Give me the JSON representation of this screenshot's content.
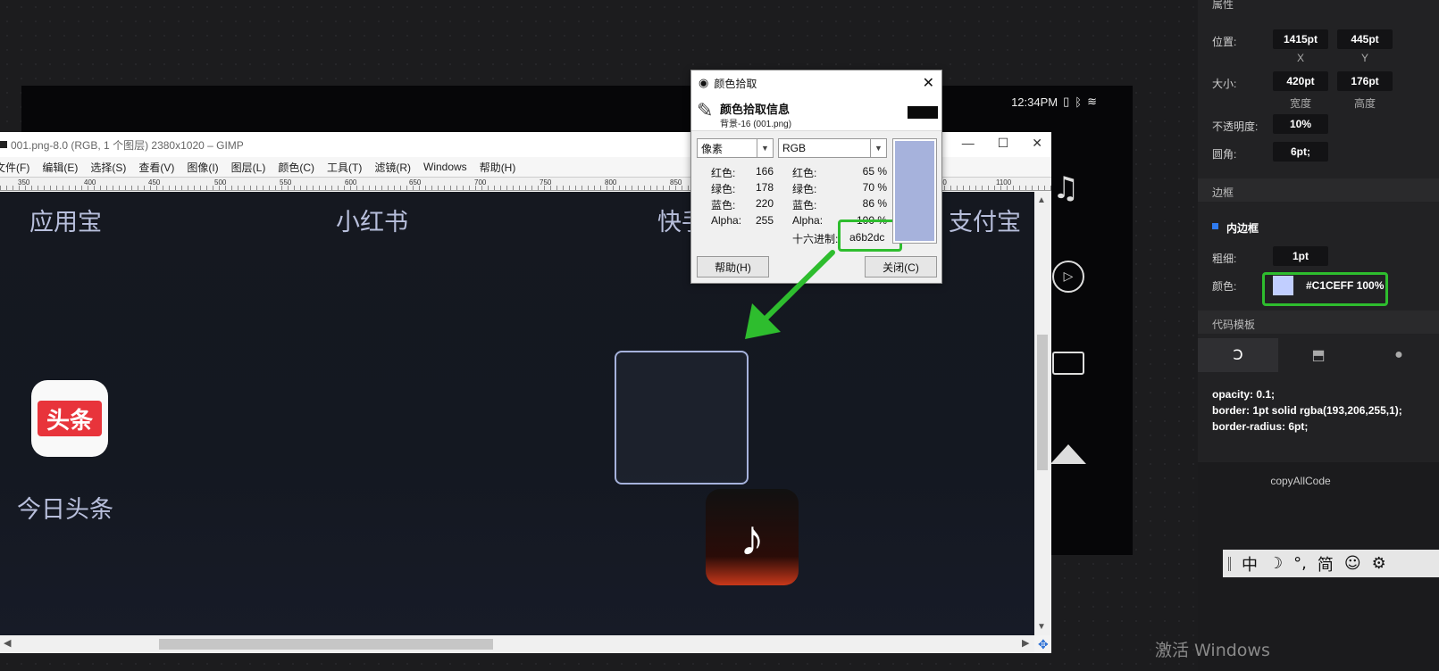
{
  "phone": {
    "time": "12:34PM"
  },
  "gimp": {
    "title": "001.png-8.0 (RGB, 1 个图层) 2380x1020 – GIMP",
    "menu": [
      "文件(F)",
      "编辑(E)",
      "选择(S)",
      "查看(V)",
      "图像(I)",
      "图层(L)",
      "颜色(C)",
      "工具(T)",
      "滤镜(R)",
      "Windows",
      "帮助(H)"
    ],
    "ruler_ticks": [
      "350",
      "400",
      "450",
      "500",
      "550",
      "600",
      "650",
      "700",
      "750",
      "800",
      "850",
      "900",
      "950",
      "1000",
      "1050",
      "1100"
    ],
    "apps": {
      "yingyongbao": "应用宝",
      "xiaohongshu": "小红书",
      "kuaishou": "快手",
      "zhifubao": "支付宝",
      "toutiao_label": "今日头条",
      "toutiao_icon_text": "头条"
    }
  },
  "picker": {
    "window_title": "颜色拾取",
    "header_title": "颜色拾取信息",
    "header_sub": "背景-16 (001.png)",
    "left_select": "像素",
    "right_select": "RGB",
    "left_rows": [
      {
        "label": "红色:",
        "value": "166"
      },
      {
        "label": "绿色:",
        "value": "178"
      },
      {
        "label": "蓝色:",
        "value": "220"
      },
      {
        "label": "Alpha:",
        "value": "255"
      }
    ],
    "right_rows": [
      {
        "label": "红色:",
        "value": "65 %"
      },
      {
        "label": "绿色:",
        "value": "70 %"
      },
      {
        "label": "蓝色:",
        "value": "86 %"
      },
      {
        "label": "Alpha:",
        "value": "100 %"
      }
    ],
    "hex_label": "十六进制:",
    "hex_value": "a6b2dc",
    "swatch_color": "#a6b2dc",
    "help_button": "帮助(H)",
    "close_button": "关闭(C)"
  },
  "panel": {
    "attr_title": "属性",
    "position_label": "位置:",
    "pos_x": "1415pt",
    "pos_y": "445pt",
    "x_cap": "X",
    "y_cap": "Y",
    "size_label": "大小:",
    "width_val": "420pt",
    "height_val": "176pt",
    "width_cap": "宽度",
    "height_cap": "高度",
    "opacity_label": "不透明度:",
    "opacity_val": "10%",
    "radius_label": "圆角:",
    "radius_val": "6pt;",
    "border_title": "边框",
    "inner_border": "内边框",
    "thickness_label": "粗细:",
    "thickness_val": "1pt",
    "color_label": "颜色:",
    "color_val": "#C1CEFF 100%",
    "color_chip": "#c1ceff",
    "code_title": "代码模板",
    "code_lines": [
      "opacity: 0.1;",
      "border: 1pt solid rgba(193,206,255,1);",
      "border-radius: 6pt;"
    ],
    "copy_button": "copyAllCode"
  },
  "ime": {
    "mode": "中",
    "punct": "°,",
    "simp": "简"
  },
  "watermark": "激活 Windows",
  "accent_green": "#2ebd2e"
}
